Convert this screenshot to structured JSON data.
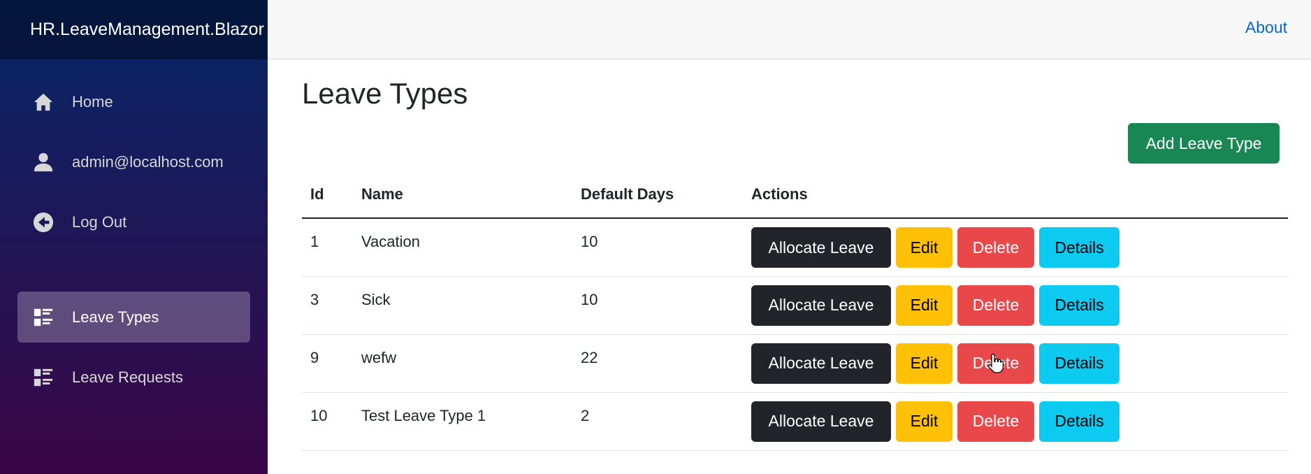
{
  "brand": "HR.LeaveManagement.Blazor",
  "nav": {
    "items": [
      {
        "label": "Home",
        "icon": "home-icon"
      },
      {
        "label": "admin@localhost.com",
        "icon": "person-icon"
      },
      {
        "label": "Log Out",
        "icon": "arrow-left-circle-icon"
      },
      {
        "label": "Leave Types",
        "icon": "list-rich-icon",
        "active": true
      },
      {
        "label": "Leave Requests",
        "icon": "list-rich-icon"
      }
    ]
  },
  "top_row": {
    "about": "About"
  },
  "page": {
    "title": "Leave Types",
    "add_button": "Add Leave Type"
  },
  "table": {
    "headers": [
      "Id",
      "Name",
      "Default Days",
      "Actions"
    ],
    "rows": [
      {
        "id": "1",
        "name": "Vacation",
        "days": "10"
      },
      {
        "id": "3",
        "name": "Sick",
        "days": "10"
      },
      {
        "id": "9",
        "name": "wefw",
        "days": "22"
      },
      {
        "id": "10",
        "name": "Test Leave Type 1",
        "days": "2"
      }
    ],
    "actions": {
      "allocate": "Allocate Leave",
      "edit": "Edit",
      "delete": "Delete",
      "details": "Details"
    }
  },
  "colors": {
    "add": "#198754",
    "allocate": "#212529",
    "edit": "#ffc107",
    "delete": "#e9484b",
    "details": "#0dcaf0",
    "link": "#0366d6"
  }
}
